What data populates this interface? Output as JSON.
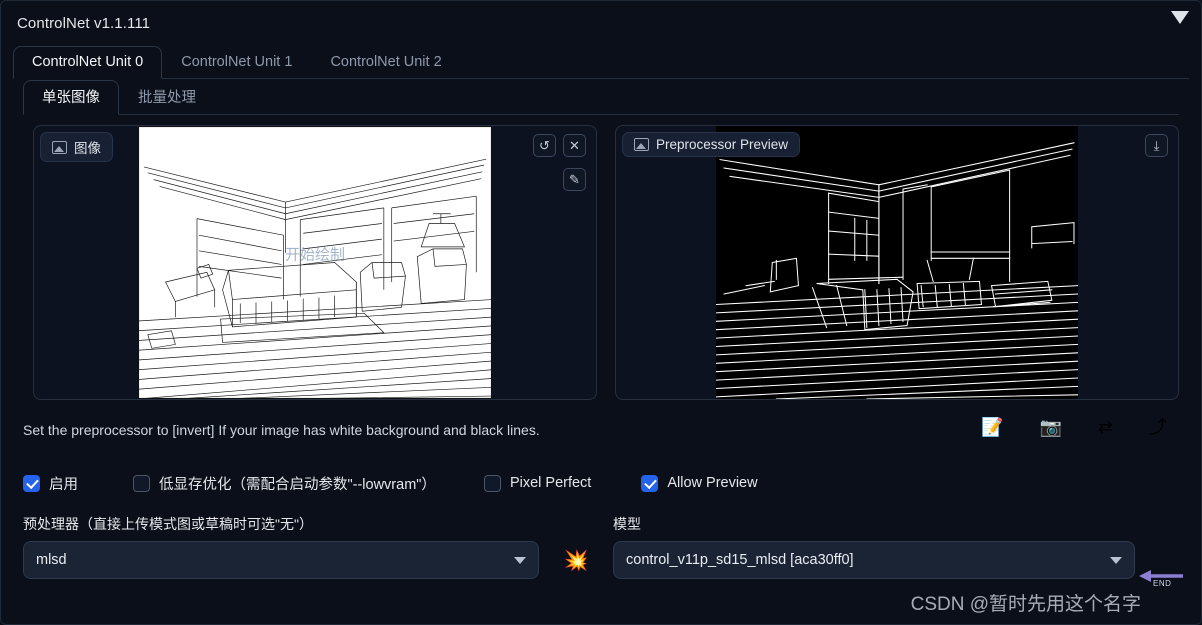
{
  "header": {
    "title": "ControlNet v1.1.111",
    "collapse_icon": "chevron-down-icon"
  },
  "unit_tabs": [
    {
      "label": "ControlNet Unit 0",
      "active": true
    },
    {
      "label": "ControlNet Unit 1",
      "active": false
    },
    {
      "label": "ControlNet Unit 2",
      "active": false
    }
  ],
  "sub_tabs": [
    {
      "label": "单张图像",
      "active": true
    },
    {
      "label": "批量处理",
      "active": false
    }
  ],
  "image_panel": {
    "label": "图像",
    "label_icon": "image-icon",
    "watermark": "开始绘制",
    "buttons": [
      {
        "name": "undo-button",
        "glyph": "↺"
      },
      {
        "name": "clear-button",
        "glyph": "✕"
      },
      {
        "name": "pen-button",
        "glyph": "✎"
      }
    ]
  },
  "preview_panel": {
    "label": "Preprocessor Preview",
    "label_icon": "image-icon",
    "buttons": [
      {
        "name": "download-button",
        "glyph": "⤓"
      }
    ]
  },
  "hint": {
    "text": "Set the preprocessor to [invert] If your image has white background and black lines."
  },
  "action_icons": [
    {
      "name": "memo-icon",
      "glyph": "📝"
    },
    {
      "name": "camera-icon",
      "glyph": "📷"
    },
    {
      "name": "swap-icon",
      "glyph": "⇄"
    },
    {
      "name": "arrow-curve-icon",
      "glyph": "⤴"
    }
  ],
  "checkboxes": [
    {
      "label": "启用",
      "checked": true
    },
    {
      "label": "低显存优化（需配合启动参数\"--lowvram\"）",
      "checked": false
    },
    {
      "label": "Pixel Perfect",
      "checked": false
    },
    {
      "label": "Allow Preview",
      "checked": true
    }
  ],
  "preprocessor": {
    "label": "预处理器（直接上传模式图或草稿时可选\"无\"）",
    "value": "mlsd"
  },
  "model": {
    "label": "模型",
    "value": "control_v11p_sd15_mlsd [aca30ff0]"
  },
  "spark": {
    "glyph": "💥",
    "name": "explosion-icon"
  },
  "overlay": {
    "watermark": "CSDN @暂时先用这个名字",
    "end_label": "END"
  },
  "colors": {
    "background": "#0b0f19",
    "accent": "#2563eb",
    "panel": "#0d1220",
    "border": "#27303f",
    "text": "#e5e7eb"
  }
}
